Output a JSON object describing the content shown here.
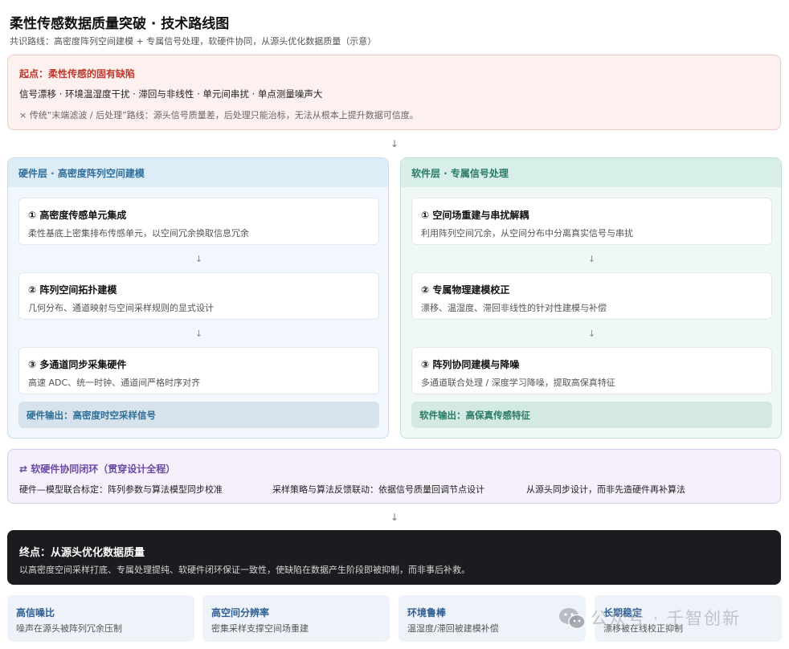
{
  "header": {
    "title": "柔性传感数据质量突破 · 技术路线图",
    "subtitle": "共识路线：高密度阵列空间建模 + 专属信号处理，软硬件协同，从源头优化数据质量（示意）"
  },
  "start": {
    "title": "起点：柔性传感的固有缺陷",
    "issues": "信号漂移 · 环境温湿度干扰 · 滞回与非线性 · 单元间串扰 · 单点测量噪声大",
    "note": "× 传统“末端滤波 / 后处理”路线：源头信号质量差，后处理只能治标，无法从根本上提升数据可信度。"
  },
  "arrow_glyph": "↓",
  "hardware": {
    "title": "硬件层 · 高密度阵列空间建模",
    "steps": [
      {
        "title": "① 高密度传感单元集成",
        "desc": "柔性基底上密集排布传感单元，以空间冗余换取信息冗余"
      },
      {
        "title": "② 阵列空间拓扑建模",
        "desc": "几何分布、通道映射与空间采样规则的显式设计"
      },
      {
        "title": "③ 多通道同步采集硬件",
        "desc": "高速 ADC、统一时钟、通道间严格时序对齐"
      }
    ],
    "output": "硬件输出：高密度时空采样信号"
  },
  "software": {
    "title": "软件层 · 专属信号处理",
    "steps": [
      {
        "title": "① 空间场重建与串扰解耦",
        "desc": "利用阵列空间冗余，从空间分布中分离真实信号与串扰"
      },
      {
        "title": "② 专属物理建模校正",
        "desc": "漂移、温湿度、滞回非线性的针对性建模与补偿"
      },
      {
        "title": "③ 阵列协同建模与降噪",
        "desc": "多通道联合处理 / 深度学习降噪，提取高保真特征"
      }
    ],
    "output": "软件输出：高保真传感特征"
  },
  "loop": {
    "title": "⇄ 软硬件协同闭环（贯穿设计全程）",
    "items": [
      "硬件—模型联合标定：阵列参数与算法模型同步校准",
      "采样策略与算法反馈联动：依据信号质量回调节点设计",
      "从源头同步设计，而非先造硬件再补算法"
    ]
  },
  "end": {
    "title": "终点：从源头优化数据质量",
    "desc": "以高密度空间采样打底、专属处理提纯、软硬件闭环保证一致性，使缺陷在数据产生阶段即被抑制，而非事后补救。"
  },
  "outcomes": [
    {
      "title": "高信噪比",
      "desc": "噪声在源头被阵列冗余压制"
    },
    {
      "title": "高空间分辨率",
      "desc": "密集采样支撑空间场重建"
    },
    {
      "title": "环境鲁棒",
      "desc": "温湿度/滞回被建模补偿"
    },
    {
      "title": "长期稳定",
      "desc": "漂移被在线校正抑制"
    }
  ],
  "watermark": {
    "icon": "wechat-icon",
    "text": "公众号 · 千智创新"
  },
  "colors": {
    "start_accent": "#c0392b",
    "hardware_accent": "#2f6e99",
    "software_accent": "#2a7a69",
    "loop_accent": "#6b4aa6",
    "end_bg": "#1b1c1f"
  }
}
